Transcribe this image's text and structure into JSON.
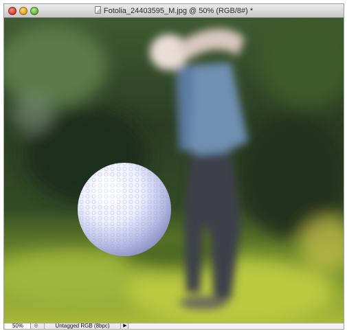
{
  "window": {
    "title": "Fotolia_24403595_M.jpg @ 50% (RGB/8#) *"
  },
  "statusbar": {
    "zoom": "50%",
    "doc_info": "Untagged RGB (8bpc)",
    "info_icon": "◎",
    "menu_arrow": "▶"
  },
  "icons": {
    "close": "close-icon",
    "minimize": "minimize-icon",
    "zoom": "zoom-icon",
    "document": "document-icon"
  }
}
